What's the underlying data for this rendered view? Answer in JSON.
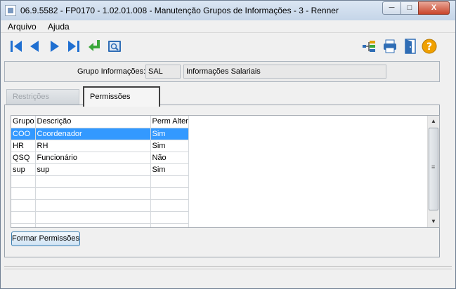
{
  "window": {
    "title": "06.9.5582 - FP0170 - 1.02.01.008 - Manutenção Grupos de Informações - 3 - Renner",
    "minimize_label": "─",
    "maximize_label": "□",
    "close_label": "X"
  },
  "menu": {
    "items": [
      {
        "label": "Arquivo"
      },
      {
        "label": "Ajuda"
      }
    ]
  },
  "toolbar": {
    "icons": [
      "first-record-icon",
      "previous-record-icon",
      "next-record-icon",
      "last-record-icon",
      "return-icon",
      "search-icon",
      "tree-icon",
      "print-icon",
      "exit-door-icon",
      "help-icon"
    ],
    "colors": {
      "nav_blue": "#1f6fd1",
      "return_green": "#3aa83a",
      "help_orange": "#f0a000"
    }
  },
  "group": {
    "label": "Grupo Informações:",
    "code": "SAL",
    "description": "Informações Salariais"
  },
  "tabs": [
    {
      "label": "Restrições",
      "active": false
    },
    {
      "label": "Permissões",
      "active": true
    }
  ],
  "grid": {
    "columns": [
      "Grupo",
      "Descrição",
      "Perm Alter"
    ],
    "rows": [
      {
        "grupo": "COO",
        "descricao": "Coordenador",
        "perm": "Sim",
        "selected": true
      },
      {
        "grupo": "HR",
        "descricao": "RH",
        "perm": "Sim",
        "selected": false
      },
      {
        "grupo": "QSQ",
        "descricao": "Funcionário",
        "perm": "Não",
        "selected": false
      },
      {
        "grupo": "sup",
        "descricao": "sup",
        "perm": "Sim",
        "selected": false
      }
    ],
    "empty_rows": 5,
    "selection_color": "#3399ff"
  },
  "buttons": {
    "formar_permissoes": "Formar Permissões"
  }
}
